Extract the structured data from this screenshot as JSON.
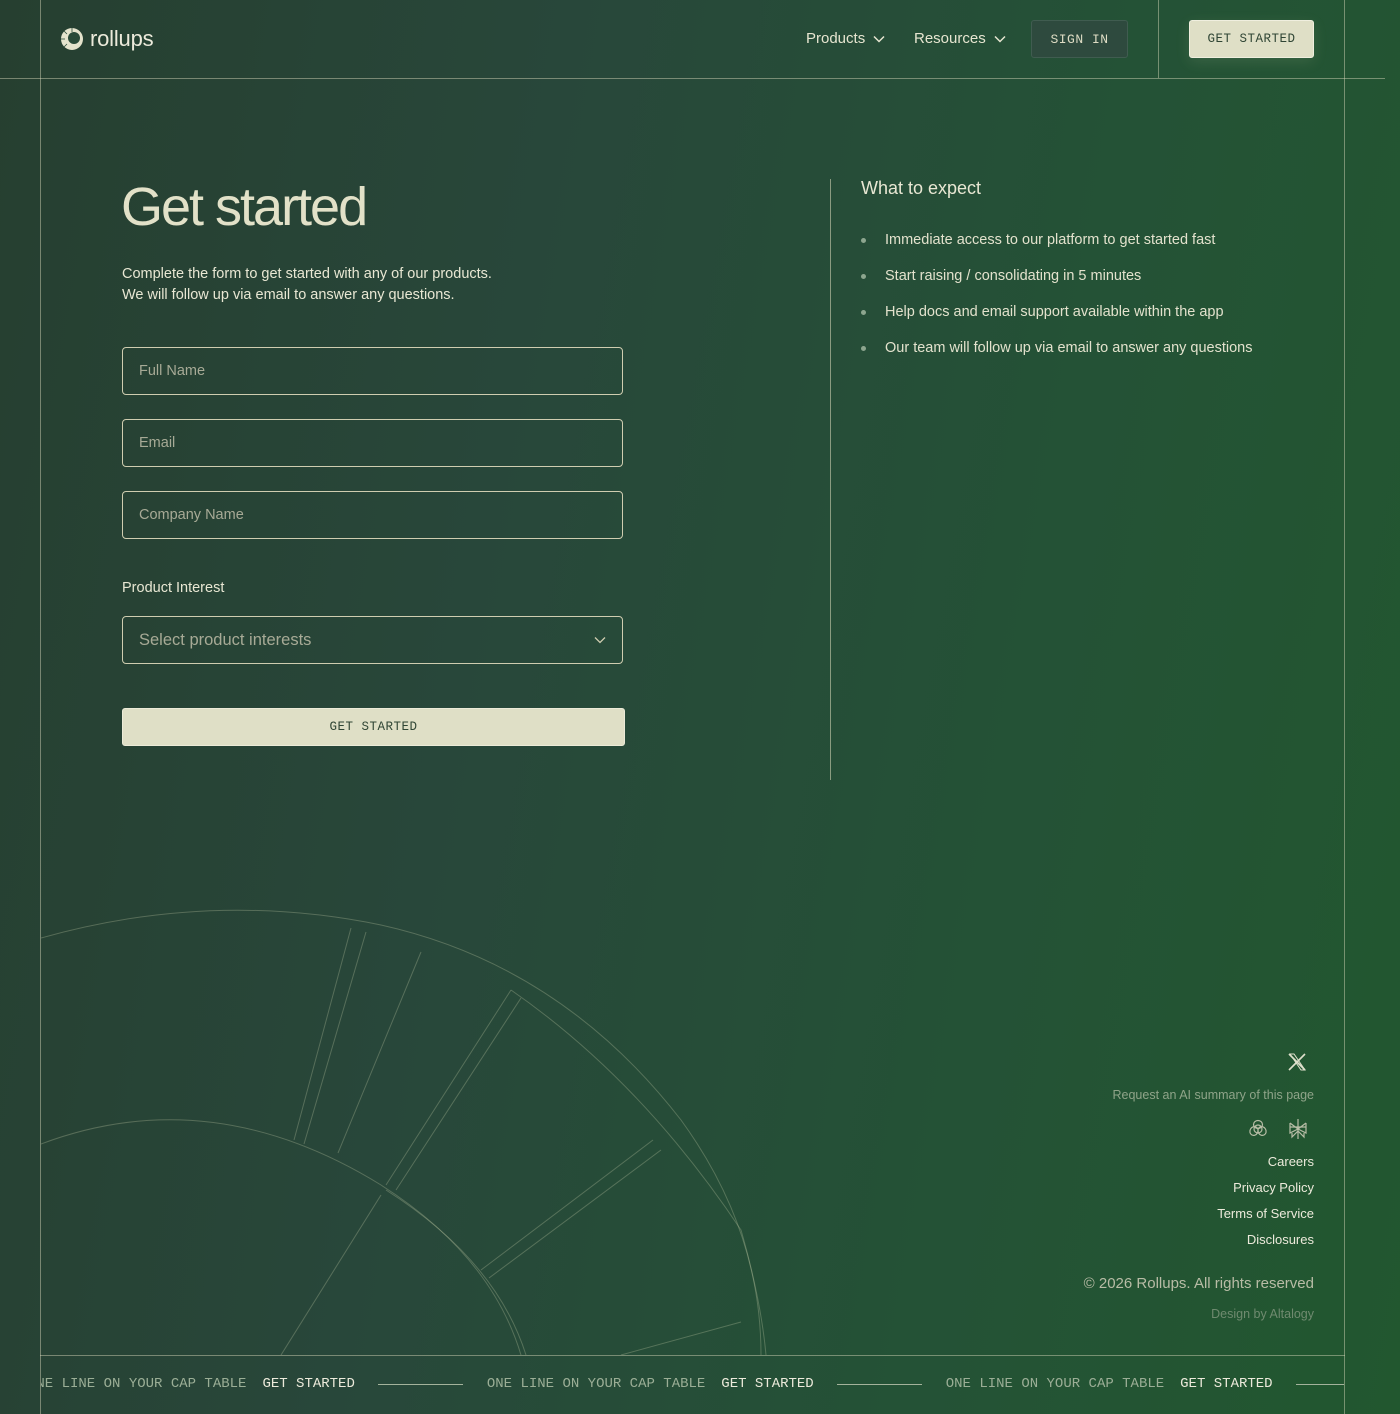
{
  "header": {
    "logo_text": "rollups",
    "nav": [
      {
        "label": "Products",
        "icon": "chevron-down-icon"
      },
      {
        "label": "Resources",
        "icon": "chevron-down-icon"
      }
    ],
    "signin_label": "SIGN IN",
    "cta_label": "GET STARTED"
  },
  "form": {
    "title": "Get started",
    "subtitle_line1": "Complete the form to get started with any of our products.",
    "subtitle_line2": "We will follow up via email to answer any questions.",
    "full_name_placeholder": "Full Name",
    "email_placeholder": "Email",
    "company_placeholder": "Company Name",
    "product_interest_label": "Product Interest",
    "select_placeholder": "Select product interests",
    "submit_label": "GET STARTED"
  },
  "expect": {
    "title": "What to expect",
    "items": [
      "Immediate access to our platform to get started fast",
      "Start raising / consolidating in 5 minutes",
      "Help docs and email support available within the app",
      "Our team will follow up via email to answer any questions"
    ]
  },
  "footer": {
    "social_icon": "x-icon",
    "ai_summary_text": "Request an AI summary of this page",
    "ai_icons": [
      "openai-icon",
      "perplexity-icon"
    ],
    "links": [
      "Careers",
      "Privacy Policy",
      "Terms of Service",
      "Disclosures"
    ],
    "copyright": "© 2026  Rollups. All rights reserved",
    "design_credit": "Design by Altalogy"
  },
  "ticker": {
    "text": "ONE LINE ON YOUR CAP TABLE",
    "cta": "GET STARTED"
  },
  "colors": {
    "background": "#26473a",
    "accent_button": "#dfdfc6",
    "text": "#e8e7d3",
    "muted": "#8fa489"
  }
}
